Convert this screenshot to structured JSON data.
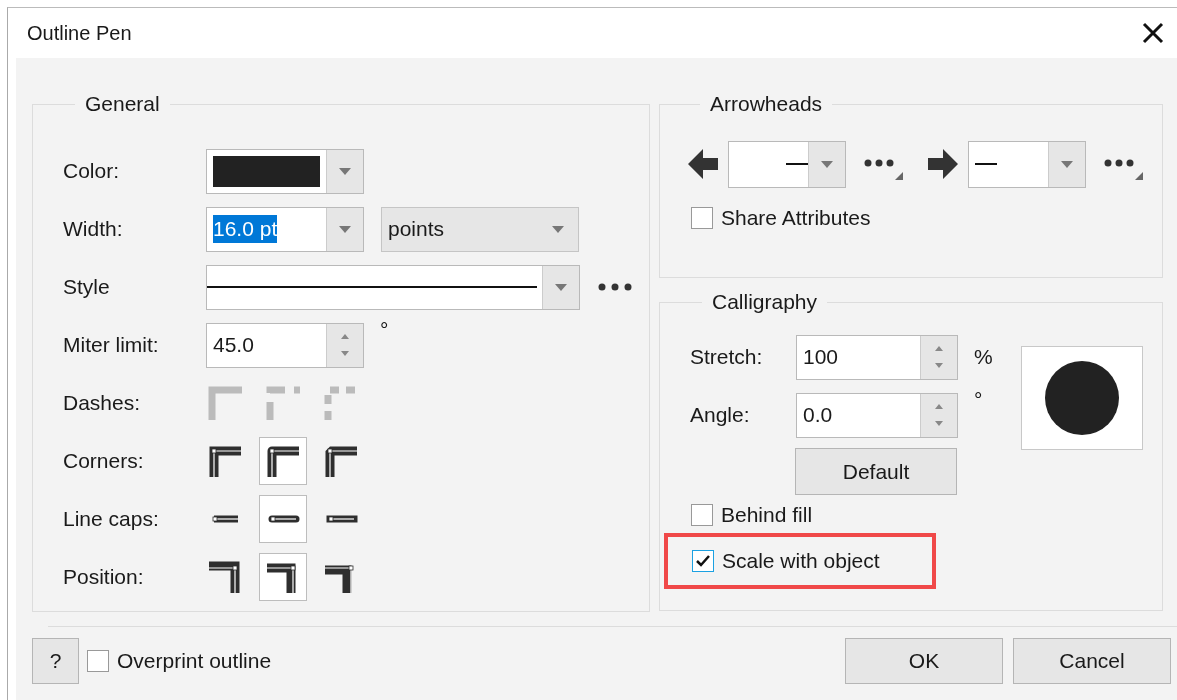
{
  "window": {
    "title": "Outline Pen"
  },
  "general": {
    "title": "General",
    "color": {
      "label": "Color:",
      "color": "#222222"
    },
    "width": {
      "label": "Width:",
      "value": "16.0 pt",
      "text_selected": true,
      "units": "points"
    },
    "style": {
      "label": "Style"
    },
    "miter_limit": {
      "label": "Miter limit:",
      "value": "45.0",
      "unit": "°"
    },
    "icon_rows": [
      {
        "kind": "dashes",
        "label": "Dashes:",
        "disabled": true,
        "options": [
          {
            "selected": false
          },
          {
            "selected": false
          },
          {
            "selected": false
          }
        ]
      },
      {
        "kind": "corners",
        "label": "Corners:",
        "disabled": false,
        "options": [
          {
            "selected": false
          },
          {
            "selected": true
          },
          {
            "selected": false
          }
        ]
      },
      {
        "kind": "caps",
        "label": "Line caps:",
        "disabled": false,
        "options": [
          {
            "selected": false
          },
          {
            "selected": true
          },
          {
            "selected": false
          }
        ]
      },
      {
        "kind": "position",
        "label": "Position:",
        "disabled": false,
        "options": [
          {
            "selected": false
          },
          {
            "selected": true
          },
          {
            "selected": false
          }
        ]
      }
    ]
  },
  "arrowheads": {
    "title": "Arrowheads",
    "share": {
      "label": "Share Attributes",
      "checked": false
    }
  },
  "calligraphy": {
    "title": "Calligraphy",
    "stretch": {
      "label": "Stretch:",
      "value": "100",
      "unit": "%"
    },
    "angle": {
      "label": "Angle:",
      "value": "0.0",
      "unit": "°"
    },
    "default_button": "Default",
    "checkboxes": [
      {
        "label": "Behind fill",
        "checked": false,
        "highlighted": false
      },
      {
        "label": "Scale with object",
        "checked": true,
        "highlighted": true
      }
    ]
  },
  "footer": {
    "help": "?",
    "overprint": {
      "label": "Overprint outline",
      "checked": false
    },
    "buttons": [
      "OK",
      "Cancel"
    ]
  }
}
